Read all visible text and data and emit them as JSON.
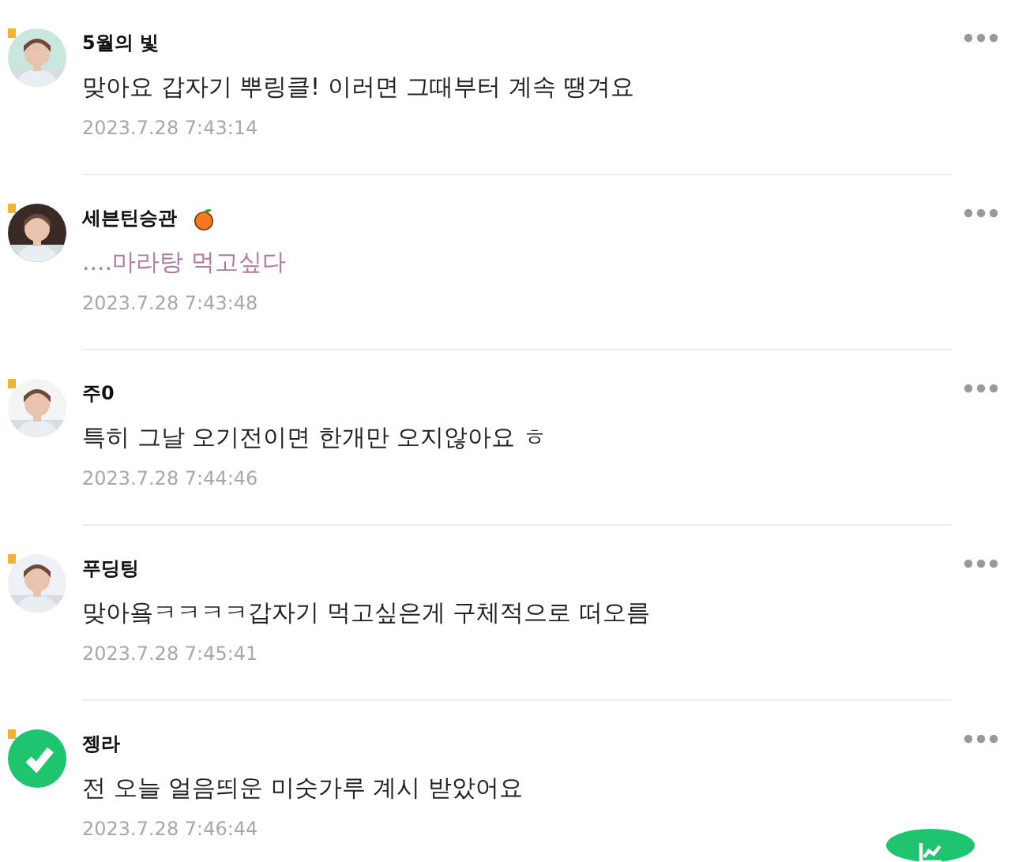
{
  "comments": [
    {
      "author": "5월의 빛",
      "text": "맞아요 갑자기 뿌링클! 이러면 그때부터 계속 땡겨요",
      "time": "2023.7.28 7:43:14"
    },
    {
      "author": "세븐틴승관",
      "emoji": true,
      "text": "....마라탕 먹고싶다",
      "color": "#b4799a",
      "time": "2023.7.28 7:43:48"
    },
    {
      "author": "주0",
      "text": "특히 그날 오기전이면 한개만 오지않아요 ㅎ",
      "time": "2023.7.28 7:44:46"
    },
    {
      "author": "푸딩팅",
      "text": "맞아욬ㅋㅋㅋㅋ갑자기 먹고싶은게 구체적으로 떠오름",
      "time": "2023.7.28 7:45:41"
    },
    {
      "author": "젱라",
      "avatar": {
        "kind": "logo"
      },
      "text": "전 오늘 얼음띄운 미숫가루 계시 받았어요",
      "time": "2023.7.28 7:46:44"
    }
  ]
}
